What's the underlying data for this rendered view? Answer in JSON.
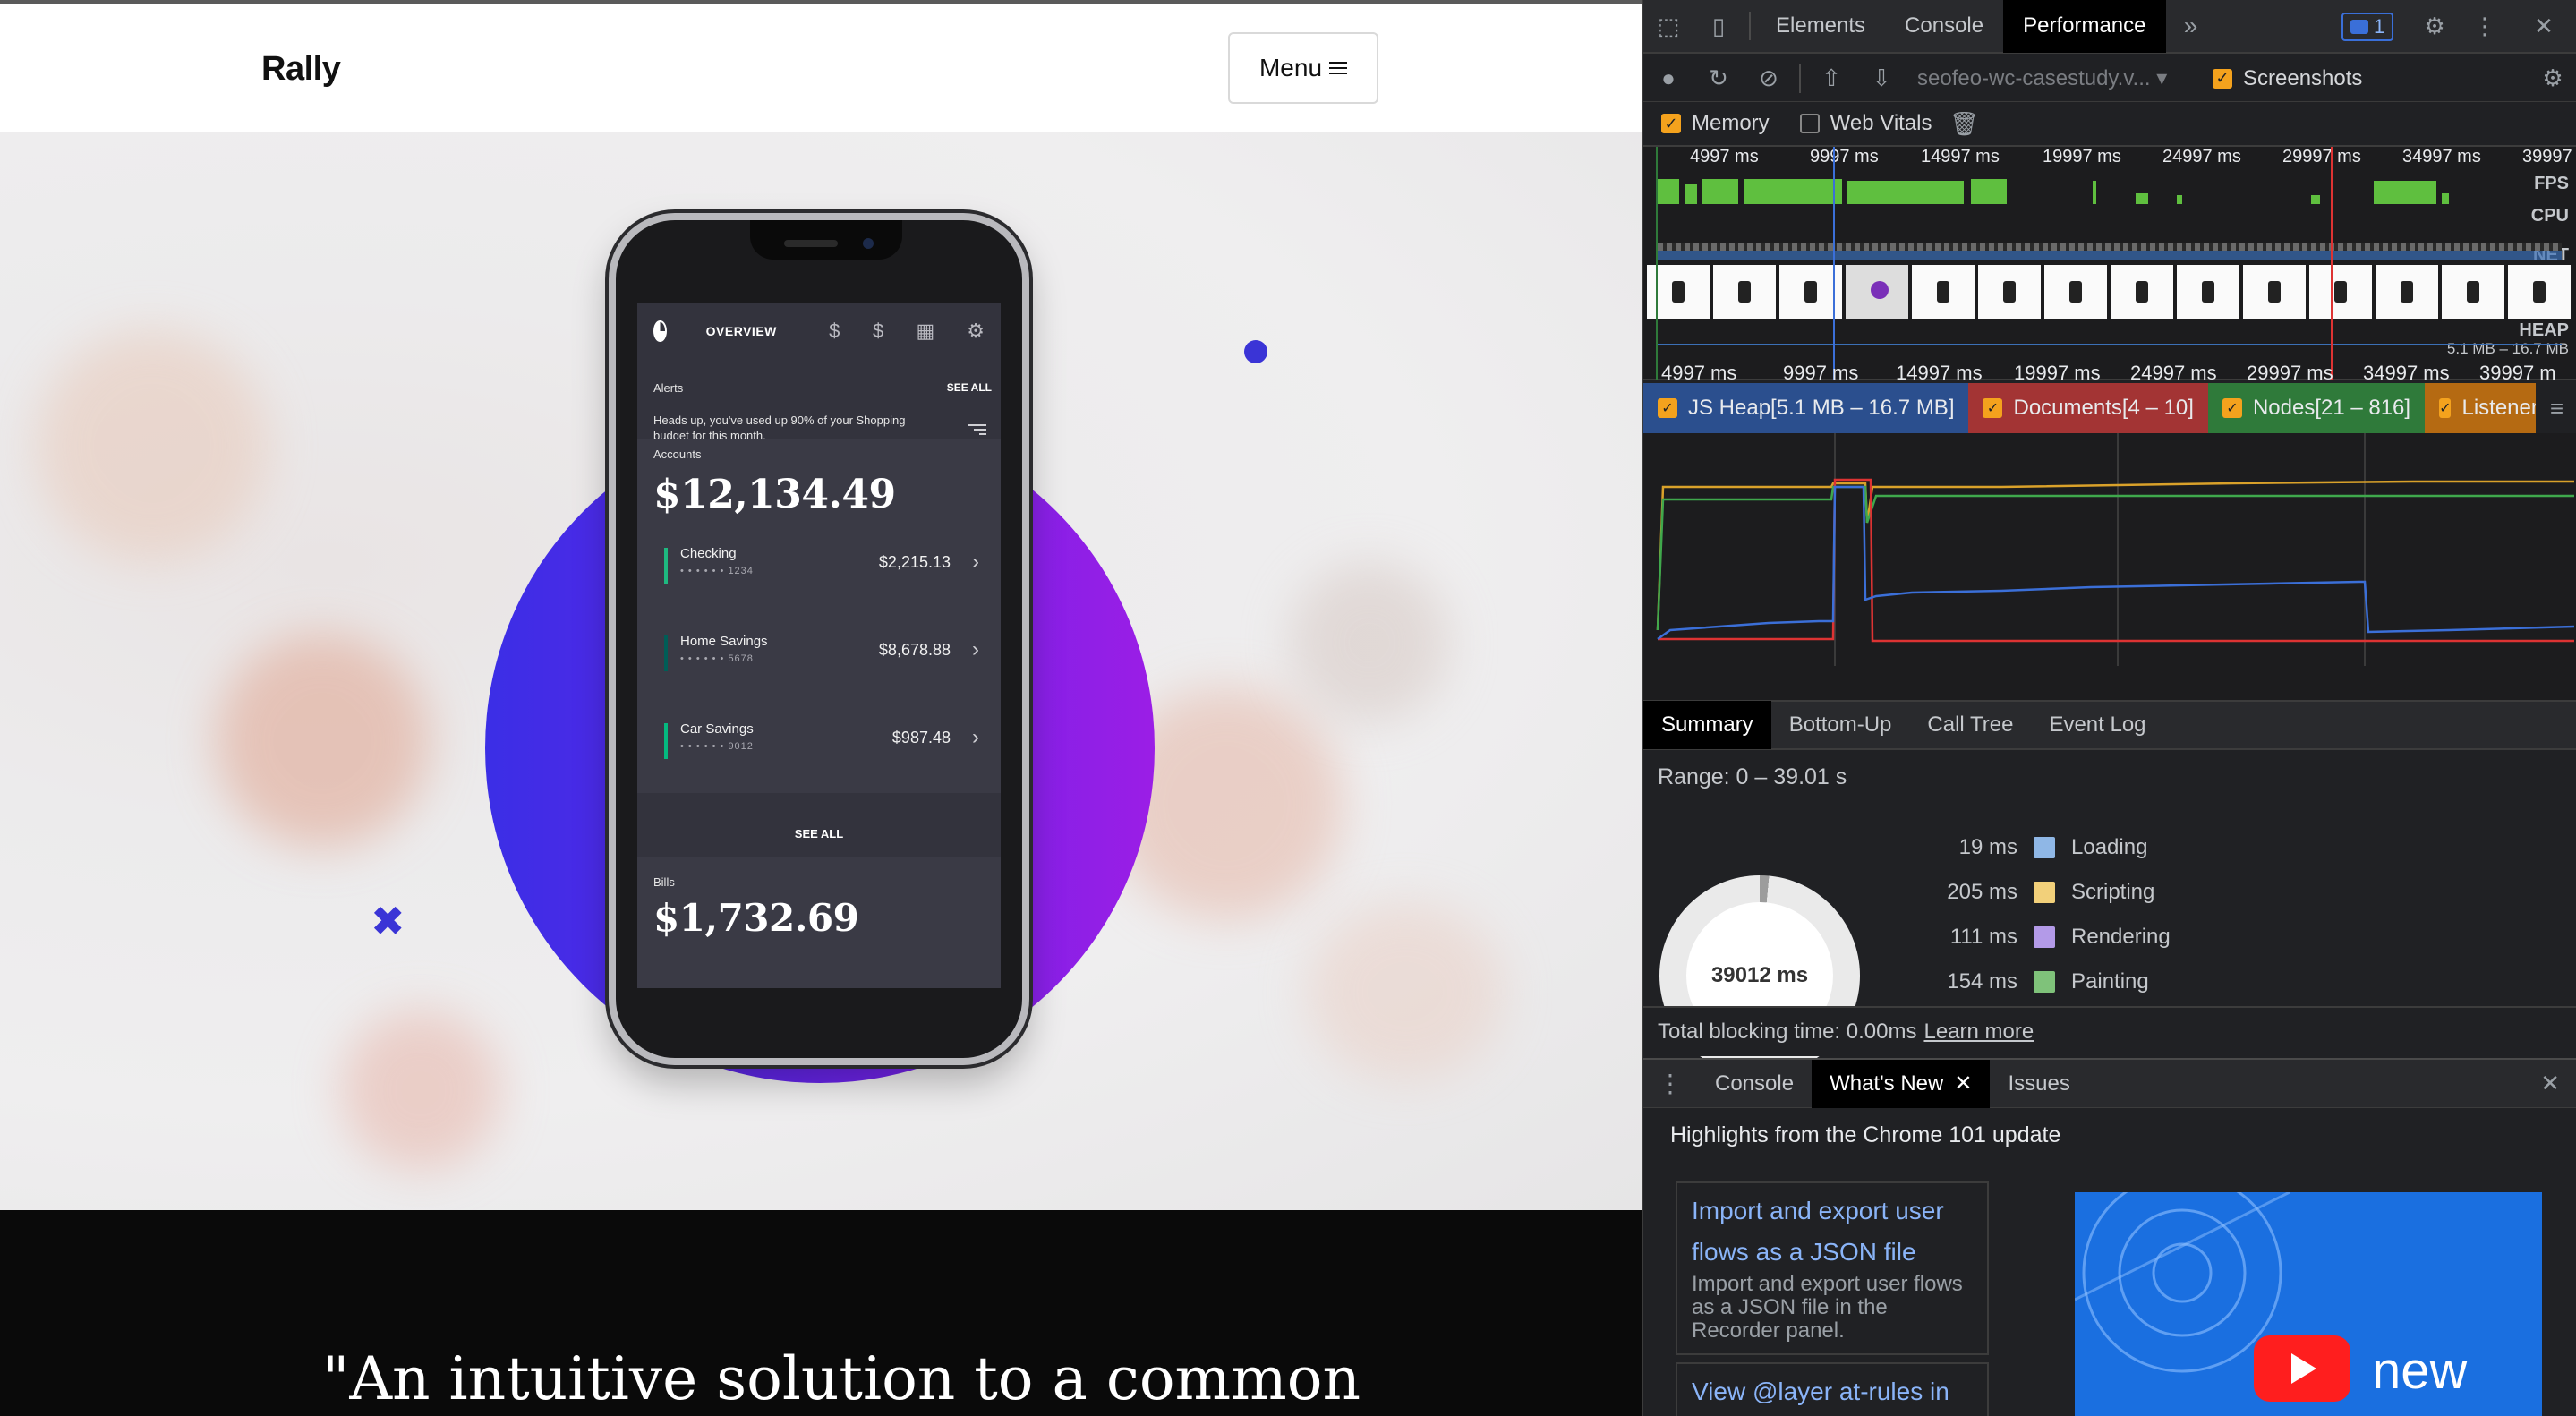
{
  "site": {
    "logo": "Rally",
    "menu_label": "Menu",
    "quote": "\"An intuitive solution to a common",
    "phone": {
      "nav_title": "OVERVIEW",
      "alerts_label": "Alerts",
      "alerts_seeall": "SEE ALL",
      "alert_text": "Heads up, you've used up 90% of your Shopping budget for this month.",
      "accounts_label": "Accounts",
      "accounts_total": "$12,134.49",
      "accounts": [
        {
          "name": "Checking",
          "number": "• • • • • • 1234",
          "amount": "$2,215.13",
          "color": "#1eb980"
        },
        {
          "name": "Home Savings",
          "number": "• • • • • • 5678",
          "amount": "$8,678.88",
          "color": "#005d57"
        },
        {
          "name": "Car Savings",
          "number": "• • • • • • 9012",
          "amount": "$987.48",
          "color": "#04b97f"
        }
      ],
      "accounts_seeall": "SEE ALL",
      "bills_label": "Bills",
      "bills_total": "$1,732.69"
    }
  },
  "devtools": {
    "tabs": [
      "Elements",
      "Console",
      "Performance"
    ],
    "active_tab": "Performance",
    "issues_count": "1",
    "profile_select": "seofeo-wc-casestudy.v...",
    "screenshots_label": "Screenshots",
    "memory_label": "Memory",
    "webvitals_label": "Web Vitals",
    "overview_times_top": [
      "4997 ms",
      "9997 ms",
      "14997 ms",
      "19997 ms",
      "24997 ms",
      "29997 ms",
      "34997 ms",
      "39997"
    ],
    "overview_times_bottom": [
      "4997 ms",
      "9997 ms",
      "14997 ms",
      "19997 ms",
      "24997 ms",
      "29997 ms",
      "34997 ms",
      "39997 m"
    ],
    "lanes": {
      "fps": "FPS",
      "cpu": "CPU",
      "net": "NET",
      "heap": "HEAP",
      "heap_range": "5.1 MB – 16.7 MB"
    },
    "counters": [
      {
        "label": "JS Heap[5.1 MB – 16.7 MB]",
        "color": "#2b4f8e"
      },
      {
        "label": "Documents[4 – 10]",
        "color": "#a33434"
      },
      {
        "label": "Nodes[21 – 816]",
        "color": "#2f7a3a"
      },
      {
        "label": "Listener",
        "color": "#b56a12"
      }
    ],
    "summary_tabs": [
      "Summary",
      "Bottom-Up",
      "Call Tree",
      "Event Log"
    ],
    "range": "Range: 0 – 39.01 s",
    "total_ms": "39012 ms",
    "legend": [
      {
        "ms": "19 ms",
        "name": "Loading",
        "color": "#8fb7e6"
      },
      {
        "ms": "205 ms",
        "name": "Scripting",
        "color": "#f2d07a"
      },
      {
        "ms": "111 ms",
        "name": "Rendering",
        "color": "#b39ae8"
      },
      {
        "ms": "154 ms",
        "name": "Painting",
        "color": "#7fc27a"
      }
    ],
    "tbt_label": "Total blocking time: 0.00ms",
    "learn_more": "Learn more",
    "drawer_tabs": [
      "Console",
      "What's New",
      "Issues"
    ],
    "whatsnew_title": "Highlights from the Chrome 101 update",
    "cards": [
      {
        "title": "Import and export user flows as a JSON file",
        "desc": "Import and export user flows as a JSON file in the Recorder panel."
      },
      {
        "title": "View @layer at-rules in",
        "desc": ""
      }
    ],
    "video_word": "new"
  }
}
